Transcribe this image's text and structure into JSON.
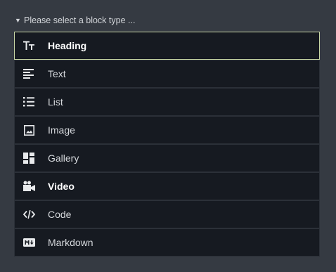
{
  "header": {
    "caret": "▼",
    "title": "Please select a block type ..."
  },
  "blocks": [
    {
      "label": "Heading",
      "icon": "heading-icon",
      "selected": true
    },
    {
      "label": "Text",
      "icon": "text-icon"
    },
    {
      "label": "List",
      "icon": "list-icon"
    },
    {
      "label": "Image",
      "icon": "image-icon"
    },
    {
      "label": "Gallery",
      "icon": "gallery-icon"
    },
    {
      "label": "Video",
      "icon": "video-icon"
    },
    {
      "label": "Code",
      "icon": "code-icon"
    },
    {
      "label": "Markdown",
      "icon": "markdown-icon"
    }
  ],
  "colors": {
    "background": "#353a42",
    "item_background": "#161a21",
    "item_border": "#2b3038",
    "selected_border": "#c8d7a5",
    "text": "#d5d8dc"
  }
}
